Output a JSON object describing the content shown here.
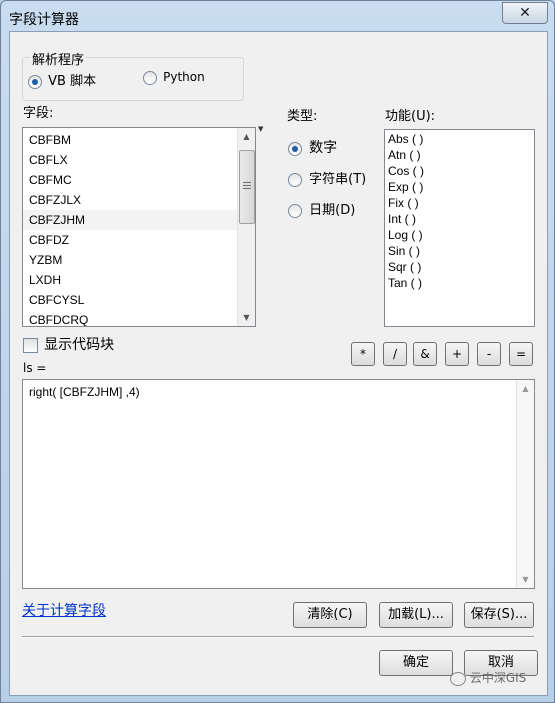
{
  "window": {
    "title": "字段计算器",
    "close_icon": "✕"
  },
  "parser": {
    "group_label": "解析程序",
    "options": [
      {
        "label": "VB 脚本",
        "selected": true
      },
      {
        "label": "Python",
        "selected": false
      }
    ]
  },
  "fields": {
    "label": "字段:",
    "items": [
      "CBFBM",
      "CBFLX",
      "CBFMC",
      "CBFZJLX",
      "CBFZJHM",
      "CBFDZ",
      "YZBM",
      "LXDH",
      "CBFCYSL",
      "CBFDCRQ"
    ]
  },
  "types": {
    "label": "类型:",
    "options": [
      {
        "label": "数字",
        "selected": true
      },
      {
        "label": "字符串(T)",
        "selected": false
      },
      {
        "label": "日期(D)",
        "selected": false
      }
    ]
  },
  "functions": {
    "label": "功能(U):",
    "items": [
      "Abs ( )",
      "Atn ( )",
      "Cos ( )",
      "Exp ( )",
      "Fix ( )",
      "Int ( )",
      "Log ( )",
      "Sin ( )",
      "Sqr ( )",
      "Tan ( )"
    ]
  },
  "show_codeblock": {
    "label": "显示代码块",
    "checked": false
  },
  "operators": [
    "*",
    "/",
    "&",
    "+",
    "-",
    "="
  ],
  "expression": {
    "label": "ls =",
    "value": "right( [CBFZJHM] ,4)"
  },
  "about_link": "关于计算字段",
  "actions": {
    "clear": "清除(C)",
    "load": "加载(L)...",
    "save": "保存(S)..."
  },
  "dialog_buttons": {
    "ok": "确定",
    "cancel": "取消"
  },
  "watermark": "云中深GIS"
}
